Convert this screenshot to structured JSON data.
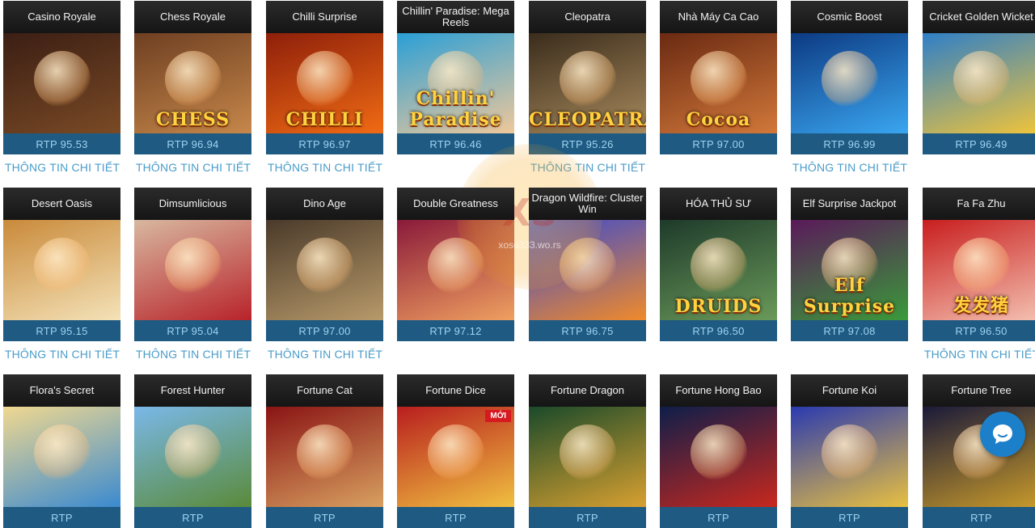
{
  "watermark": {
    "logo": "XS",
    "url": "xoso333.wo.rs"
  },
  "detail_link_label": "THÔNG TIN CHI TIẾT",
  "games": [
    {
      "title": "Casino Royale",
      "rtp": "RTP 95.53",
      "detail": true,
      "logo": "",
      "colors": [
        "#3b1e14",
        "#7a4a25"
      ]
    },
    {
      "title": "Chess Royale",
      "rtp": "RTP 96.94",
      "detail": true,
      "logo": "CHESS",
      "colors": [
        "#6e3f22",
        "#c6874a"
      ]
    },
    {
      "title": "Chilli Surprise",
      "rtp": "RTP 96.97",
      "detail": true,
      "logo": "CHILLI",
      "colors": [
        "#8e1f0a",
        "#f06b14"
      ]
    },
    {
      "title": "Chillin' Paradise: Mega Reels",
      "rtp": "RTP 96.46",
      "detail": false,
      "logo": "Chillin' Paradise",
      "colors": [
        "#2a9fd6",
        "#f0c89a"
      ]
    },
    {
      "title": "Cleopatra",
      "rtp": "RTP 95.26",
      "detail": true,
      "logo": "CLEOPATRA",
      "colors": [
        "#3a2c1c",
        "#a88a5c"
      ]
    },
    {
      "title": "Nhà Máy Ca Cao",
      "rtp": "RTP 97.00",
      "detail": false,
      "logo": "Cocoa",
      "colors": [
        "#6a2a12",
        "#d2783a"
      ]
    },
    {
      "title": "Cosmic Boost",
      "rtp": "RTP 96.99",
      "detail": true,
      "logo": "",
      "colors": [
        "#0c3a82",
        "#3aa6f0"
      ]
    },
    {
      "title": "Cricket Golden Wicket",
      "rtp": "RTP 96.49",
      "detail": false,
      "logo": "",
      "colors": [
        "#2e7fc8",
        "#f0c43a"
      ]
    },
    {
      "title": "Desert Oasis",
      "rtp": "RTP 95.15",
      "detail": true,
      "logo": "",
      "colors": [
        "#c98a3a",
        "#f4e2b8"
      ]
    },
    {
      "title": "Dimsumlicious",
      "rtp": "RTP 95.04",
      "detail": true,
      "logo": "",
      "colors": [
        "#d8b8a0",
        "#b8232a"
      ]
    },
    {
      "title": "Dino Age",
      "rtp": "RTP 97.00",
      "detail": true,
      "logo": "",
      "colors": [
        "#4a3a2a",
        "#b89a6a"
      ]
    },
    {
      "title": "Double Greatness",
      "rtp": "RTP 97.12",
      "detail": false,
      "logo": "",
      "colors": [
        "#8a1a3a",
        "#f0a060"
      ]
    },
    {
      "title": "Dragon Wildfire: Cluster Win",
      "rtp": "RTP 96.75",
      "detail": false,
      "logo": "",
      "colors": [
        "#3a4ad0",
        "#f08a2a"
      ]
    },
    {
      "title": "HÓA THỦ SƯ",
      "rtp": "RTP 96.50",
      "detail": false,
      "logo": "DRUIDS",
      "colors": [
        "#1e3a2a",
        "#6a9a5a"
      ]
    },
    {
      "title": "Elf Surprise Jackpot",
      "rtp": "RTP 97.08",
      "detail": false,
      "logo": "Elf Surprise",
      "colors": [
        "#5a1a5a",
        "#3a9a3a"
      ]
    },
    {
      "title": "Fa Fa Zhu",
      "rtp": "RTP 96.50",
      "detail": true,
      "logo": "发发猪",
      "colors": [
        "#c81e1e",
        "#f4c0b0"
      ]
    },
    {
      "title": "Flora's Secret",
      "rtp": "RTP",
      "detail": false,
      "logo": "",
      "colors": [
        "#f0d890",
        "#3a8ad0"
      ]
    },
    {
      "title": "Forest Hunter",
      "rtp": "RTP",
      "detail": false,
      "logo": "",
      "colors": [
        "#7ab8e8",
        "#5a8a3a"
      ]
    },
    {
      "title": "Fortune Cat",
      "rtp": "RTP",
      "detail": false,
      "logo": "",
      "colors": [
        "#8a1414",
        "#d8a060"
      ]
    },
    {
      "title": "Fortune Dice",
      "rtp": "RTP",
      "detail": false,
      "logo": "",
      "colors": [
        "#b81e1e",
        "#f0c040"
      ],
      "badge": "MỚI"
    },
    {
      "title": "Fortune Dragon",
      "rtp": "RTP",
      "detail": false,
      "logo": "",
      "colors": [
        "#1a4a2a",
        "#d8a030"
      ]
    },
    {
      "title": "Fortune Hong Bao",
      "rtp": "RTP",
      "detail": false,
      "logo": "",
      "colors": [
        "#0e1e4a",
        "#c8281e"
      ]
    },
    {
      "title": "Fortune Koi",
      "rtp": "RTP",
      "detail": false,
      "logo": "",
      "colors": [
        "#2a3ab0",
        "#e8c040"
      ]
    },
    {
      "title": "Fortune Tree",
      "rtp": "RTP",
      "detail": false,
      "logo": "",
      "colors": [
        "#1a1a3a",
        "#c89a2a"
      ]
    }
  ]
}
